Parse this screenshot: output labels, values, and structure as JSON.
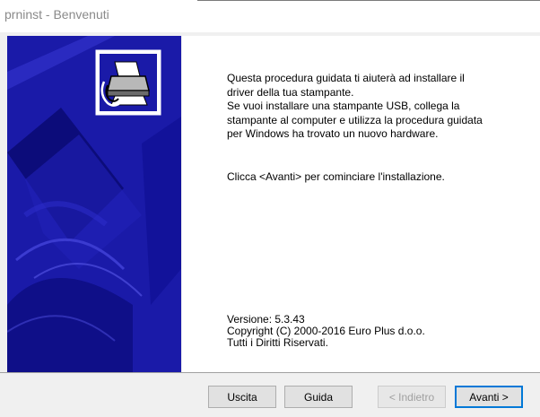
{
  "window": {
    "title": "prninst - Benvenuti"
  },
  "colors": {
    "banner_blue": "#1a1aa8",
    "banner_dark": "#0c0c7a",
    "accent": "#0078d7"
  },
  "banner": {
    "icon": "printer-setup-icon"
  },
  "content": {
    "welcome_lines": [
      "Questa procedura guidata ti aiuterà ad installare il",
      "driver della tua stampante.",
      "Se vuoi installare una stampante USB, collega la",
      "stampante al computer e utilizza la procedura guidata",
      "per Windows ha trovato un nuovo hardware."
    ],
    "click_prompt": "Clicca <Avanti> per cominciare l'installazione.",
    "version": "Versione: 5.3.43",
    "copyright": "Copyright (C) 2000-2016 Euro Plus d.o.o.",
    "rights": "Tutti i Diritti Riservati."
  },
  "buttons": {
    "exit": "Uscita",
    "help": "Guida",
    "back": "< Indietro",
    "next": "Avanti >"
  }
}
